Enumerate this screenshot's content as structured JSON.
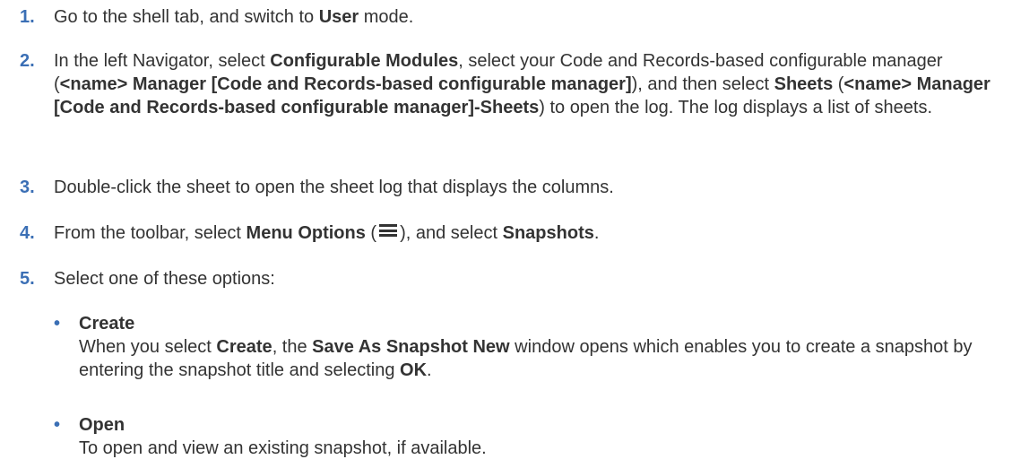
{
  "steps": [
    {
      "number": "1.",
      "t1": "Go to the shell tab, and switch to ",
      "b1": "User",
      "t2": " mode."
    },
    {
      "number": "2.",
      "t1": "In the left Navigator, select ",
      "b1": "Configurable Modules",
      "t2": ", select your Code and Records-based configurable manager (",
      "b2": "<name> Manager [Code and Records-based configurable manager]",
      "t3": "), and then select ",
      "b3": "Sheets",
      "t4": " (",
      "b4": "<name> Manager [Code and Records-based configurable manager]-Sheets",
      "t5": ") to open the log. The log displays a list of sheets."
    },
    {
      "number": "3.",
      "t1": "Double-click the sheet to open the sheet log that displays the columns."
    },
    {
      "number": "4.",
      "t1": "From the toolbar, select ",
      "b1": "Menu Options",
      "t2": " (",
      "icon": "hamburger-menu-icon",
      "t3": "), and select ",
      "b2": "Snapshots",
      "t4": "."
    },
    {
      "number": "5.",
      "t1": "Select one of these options:"
    }
  ],
  "options": [
    {
      "bullet": "•",
      "title": "Create",
      "t1": "When you select ",
      "b1": "Create",
      "t2": ", the ",
      "b2": "Save As Snapshot New",
      "t3": " window opens which enables you to create a snapshot by entering the snapshot title and selecting ",
      "b3": "OK",
      "t4": "."
    },
    {
      "bullet": "•",
      "title": "Open",
      "t1": "To open and view an existing snapshot, if available."
    }
  ]
}
